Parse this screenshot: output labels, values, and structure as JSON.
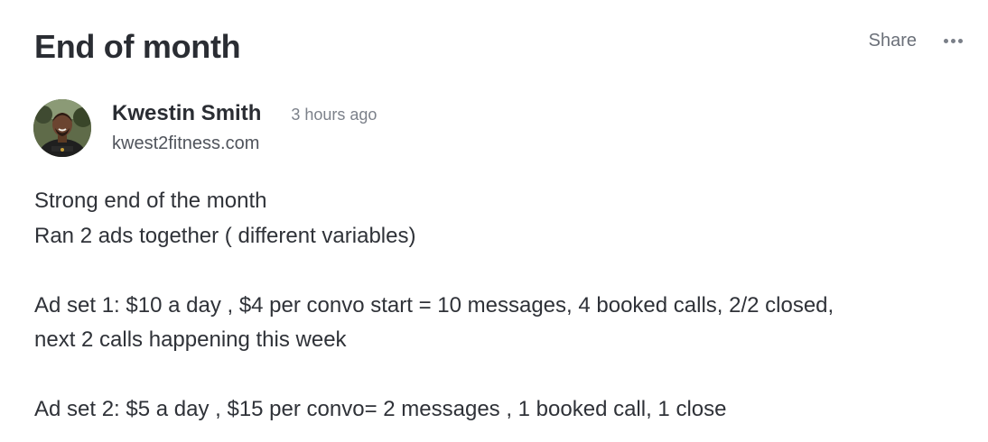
{
  "post": {
    "title": "End of month",
    "share_label": "Share",
    "more_icon": "more-horizontal-icon"
  },
  "author": {
    "name": "Kwestin Smith",
    "time": "3 hours ago",
    "website": "kwest2fitness.com"
  },
  "body": {
    "line1": "Strong end of the month",
    "line2": "Ran 2 ads together ( different variables)",
    "line3": "Ad set 1:  $10 a day , $4  per convo start = 10 messages, 4 booked calls, 2/2 closed,",
    "line4": "next 2 calls happening this week",
    "line5": "Ad set 2:  $5 a day , $15 per convo= 2 messages , 1 booked call, 1 close"
  }
}
